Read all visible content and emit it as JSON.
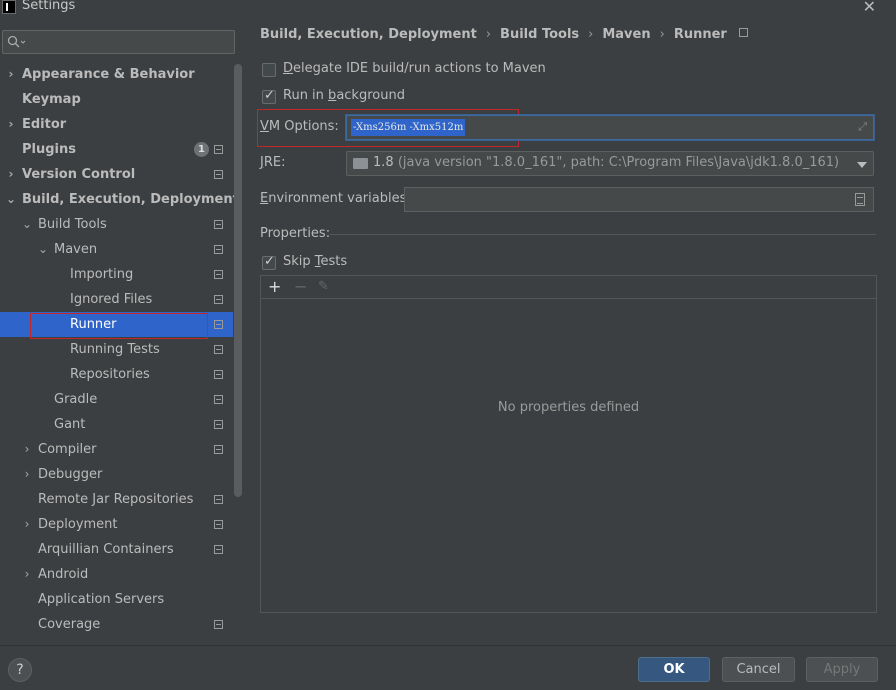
{
  "window": {
    "title": "Settings"
  },
  "search": {
    "placeholder": ""
  },
  "sidebar": {
    "items": [
      {
        "label": "Appearance & Behavior",
        "bold": true,
        "chevron": "›",
        "indent": 0,
        "project_icon": false
      },
      {
        "label": "Keymap",
        "bold": true,
        "chevron": "",
        "indent": 0,
        "project_icon": false
      },
      {
        "label": "Editor",
        "bold": true,
        "chevron": "›",
        "indent": 0,
        "project_icon": false
      },
      {
        "label": "Plugins",
        "bold": true,
        "chevron": "",
        "indent": 0,
        "project_icon": true,
        "badge": "1"
      },
      {
        "label": "Version Control",
        "bold": true,
        "chevron": "›",
        "indent": 0,
        "project_icon": true
      },
      {
        "label": "Build, Execution, Deployment",
        "bold": true,
        "chevron": "⌄",
        "indent": 0,
        "project_icon": false
      },
      {
        "label": "Build Tools",
        "bold": false,
        "chevron": "⌄",
        "indent": 1,
        "project_icon": true
      },
      {
        "label": "Maven",
        "bold": false,
        "chevron": "⌄",
        "indent": 2,
        "project_icon": true
      },
      {
        "label": "Importing",
        "bold": false,
        "chevron": "",
        "indent": 3,
        "project_icon": true
      },
      {
        "label": "Ignored Files",
        "bold": false,
        "chevron": "",
        "indent": 3,
        "project_icon": true
      },
      {
        "label": "Runner",
        "bold": false,
        "chevron": "",
        "indent": 3,
        "project_icon": true,
        "selected": true
      },
      {
        "label": "Running Tests",
        "bold": false,
        "chevron": "",
        "indent": 3,
        "project_icon": true
      },
      {
        "label": "Repositories",
        "bold": false,
        "chevron": "",
        "indent": 3,
        "project_icon": true
      },
      {
        "label": "Gradle",
        "bold": false,
        "chevron": "",
        "indent": 2,
        "project_icon": true
      },
      {
        "label": "Gant",
        "bold": false,
        "chevron": "",
        "indent": 2,
        "project_icon": true
      },
      {
        "label": "Compiler",
        "bold": false,
        "chevron": "›",
        "indent": 1,
        "project_icon": true
      },
      {
        "label": "Debugger",
        "bold": false,
        "chevron": "›",
        "indent": 1,
        "project_icon": false
      },
      {
        "label": "Remote Jar Repositories",
        "bold": false,
        "chevron": "",
        "indent": 1,
        "project_icon": true
      },
      {
        "label": "Deployment",
        "bold": false,
        "chevron": "›",
        "indent": 1,
        "project_icon": true
      },
      {
        "label": "Arquillian Containers",
        "bold": false,
        "chevron": "",
        "indent": 1,
        "project_icon": true
      },
      {
        "label": "Android",
        "bold": false,
        "chevron": "›",
        "indent": 1,
        "project_icon": false
      },
      {
        "label": "Application Servers",
        "bold": false,
        "chevron": "",
        "indent": 1,
        "project_icon": false
      },
      {
        "label": "Coverage",
        "bold": false,
        "chevron": "",
        "indent": 1,
        "project_icon": true
      }
    ]
  },
  "breadcrumb": [
    "Build, Execution, Deployment",
    "Build Tools",
    "Maven",
    "Runner"
  ],
  "options": {
    "delegate": {
      "label_u": "D",
      "label_rest": "elegate IDE build/run actions to Maven",
      "checked": false
    },
    "background": {
      "label_pre": "Run in ",
      "label_u": "b",
      "label_rest": "ackground",
      "checked": true
    }
  },
  "vm": {
    "label_u": "V",
    "label_rest": "M Options:",
    "value": "-Xms256m -Xmx512m"
  },
  "jre": {
    "label_u": "J",
    "label_rest": "RE:",
    "name": "1.8",
    "detail": "(java version \"1.8.0_161\", path: C:\\Program Files\\Java\\jdk1.8.0_161)"
  },
  "env": {
    "label_u": "E",
    "label_rest": "nvironment variables:",
    "value": ""
  },
  "properties": {
    "label": "Properties:",
    "skip_tests": {
      "label_pre": "Skip ",
      "label_u": "T",
      "label_rest": "ests",
      "checked": true
    },
    "toolbar": {
      "add": "+",
      "remove": "−",
      "edit": "✎"
    },
    "empty_text": "No properties defined"
  },
  "footer": {
    "help": "?",
    "ok": "OK",
    "cancel": "Cancel",
    "apply": "Apply"
  },
  "colors": {
    "selection": "#2f65ca",
    "ok_button": "#365880",
    "highlight_box": "#c0282a"
  }
}
